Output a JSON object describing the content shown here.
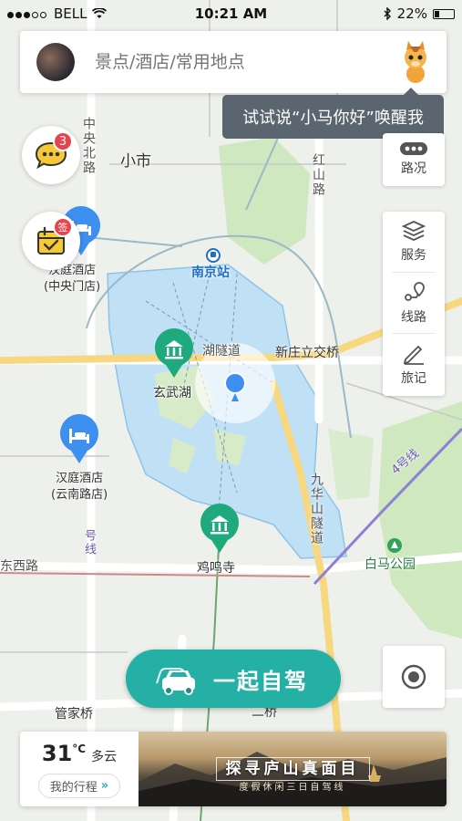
{
  "status_bar": {
    "carrier": "BELL",
    "time": "10:21 AM",
    "battery": "22%"
  },
  "search": {
    "placeholder": "景点/酒店/常用地点"
  },
  "tooltip": "试试说“小马你好”唤醒我",
  "right_panel": {
    "traffic_label": "路况",
    "buttons": [
      {
        "label": "服务",
        "icon": "layers-icon"
      },
      {
        "label": "线路",
        "icon": "route-icon"
      },
      {
        "label": "旅记",
        "icon": "pen-icon"
      }
    ]
  },
  "left_buttons": {
    "messages_badge": "3",
    "checkin_badge": "签"
  },
  "map_labels": {
    "district_xiaoshi": "小市",
    "road_zhongyang_north": "中央北路",
    "road_hongshan": "红山路",
    "station_nanjing": "南京站",
    "hotel_zhongyangmen": "汉庭酒店\n(中央门店)",
    "interchange_xinzhuang": "新庄立交桥",
    "tunnel_xuanwu_part": "湖隧道",
    "poi_xuanwu_lake": "玄武湖",
    "hotel_yunnan_road": "汉庭酒店\n(云南路店)",
    "tunnel_jiuhuashan": "九华山隧道",
    "metro_line_4": "4号线",
    "metro_line_1_part": "号线",
    "poi_baima_park": "白马公园",
    "poi_jiming_temple": "鸡鸣寺",
    "road_west_part": "东西路",
    "place_guanjiaqiao": "管家桥",
    "place_erqiao_part": "二桥"
  },
  "drive_button": "一起自驾",
  "weather": {
    "temperature": "31",
    "unit": "°C",
    "condition": "多云",
    "trip_label": "我的行程"
  },
  "banner": {
    "title": "探寻庐山真面目",
    "subtitle": "度假休闲三日自驾线"
  },
  "colors": {
    "accent": "#25b0a6",
    "lake": "#bfe0f5",
    "park": "#cfe8c0",
    "pin_green": "#1faa7e",
    "pin_blue": "#3d8ff0",
    "badge_red": "#e8424e",
    "metro_purple": "#8f7fd6",
    "tooltip_bg": "#5b6570"
  }
}
